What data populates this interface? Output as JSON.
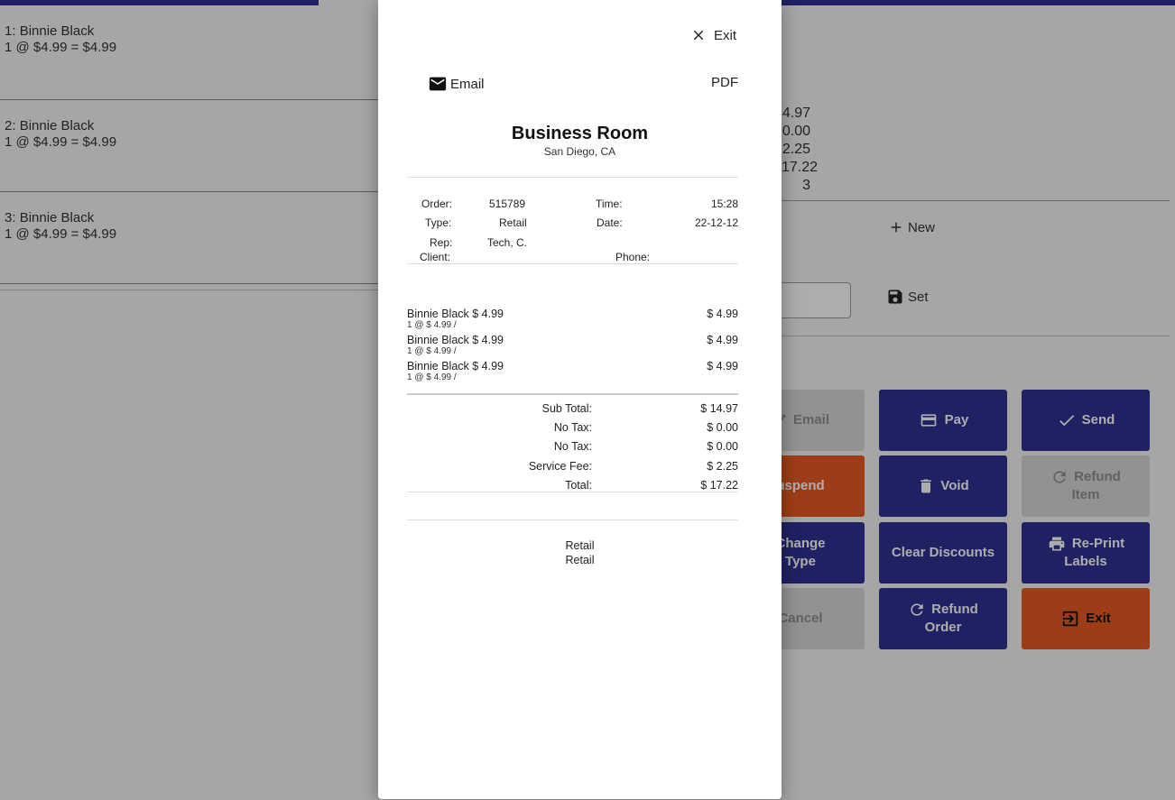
{
  "orders": [
    {
      "index": "1:",
      "name": "Binnie Black",
      "detail": "1 @ $4.99 = $4.99"
    },
    {
      "index": "2:",
      "name": "Binnie Black",
      "detail": "1 @ $4.99 = $4.99"
    },
    {
      "index": "3:",
      "name": "Binnie Black",
      "detail": "1 @ $4.99 = $4.99"
    }
  ],
  "right_panel": {
    "totals_partial": [
      "4.97",
      "0.00",
      "2.25",
      "17.22",
      "3"
    ],
    "new_label": "New",
    "set_label": "Set"
  },
  "actions": {
    "email": "Email",
    "pay": "Pay",
    "send": "Send",
    "suspend": "uspend",
    "void": "Void",
    "refund_item_1": "Refund",
    "refund_item_2": "Item",
    "change_type_1": "Change",
    "change_type_2": "Type",
    "clear_discounts": "Clear Discounts",
    "reprint_1": "Re-Print",
    "reprint_2": "Labels",
    "cancel": "Cancel",
    "refund_order_1": "Refund",
    "refund_order_2": "Order",
    "exit": "Exit"
  },
  "receipt": {
    "exit_label": "Exit",
    "email_label": "Email",
    "pdf_label": "PDF",
    "business_name": "Business Room",
    "location": "San Diego, CA",
    "info": {
      "order_label": "Order:",
      "order_value": "515789",
      "time_label": "Time:",
      "time_value": "15:28",
      "type_label": "Type:",
      "type_value": "Retail",
      "date_label": "Date:",
      "date_value": "22-12-12",
      "rep_label": "Rep:",
      "rep_value": "Tech, C.",
      "client_label": "Client:",
      "phone_label": "Phone:"
    },
    "items": [
      {
        "desc": "Binnie Black $ 4.99",
        "sub": "1 @ $ 4.99 /",
        "price": "$ 4.99"
      },
      {
        "desc": "Binnie Black $ 4.99",
        "sub": "1 @ $ 4.99 /",
        "price": "$ 4.99"
      },
      {
        "desc": "Binnie Black $ 4.99",
        "sub": "1 @ $ 4.99 /",
        "price": "$ 4.99"
      }
    ],
    "totals": [
      {
        "label": "Sub Total:",
        "value": "$ 14.97"
      },
      {
        "label": "No Tax:",
        "value": "$ 0.00"
      },
      {
        "label": "No Tax:",
        "value": "$ 0.00"
      },
      {
        "label": "Service Fee:",
        "value": "$ 2.25"
      },
      {
        "label": "Total:",
        "value": "$ 17.22"
      }
    ],
    "footer": [
      "Retail",
      "Retail"
    ]
  },
  "colors": {
    "primary": "#2e3192",
    "accent": "#e85a22",
    "disabled": "#d7d7d7"
  }
}
